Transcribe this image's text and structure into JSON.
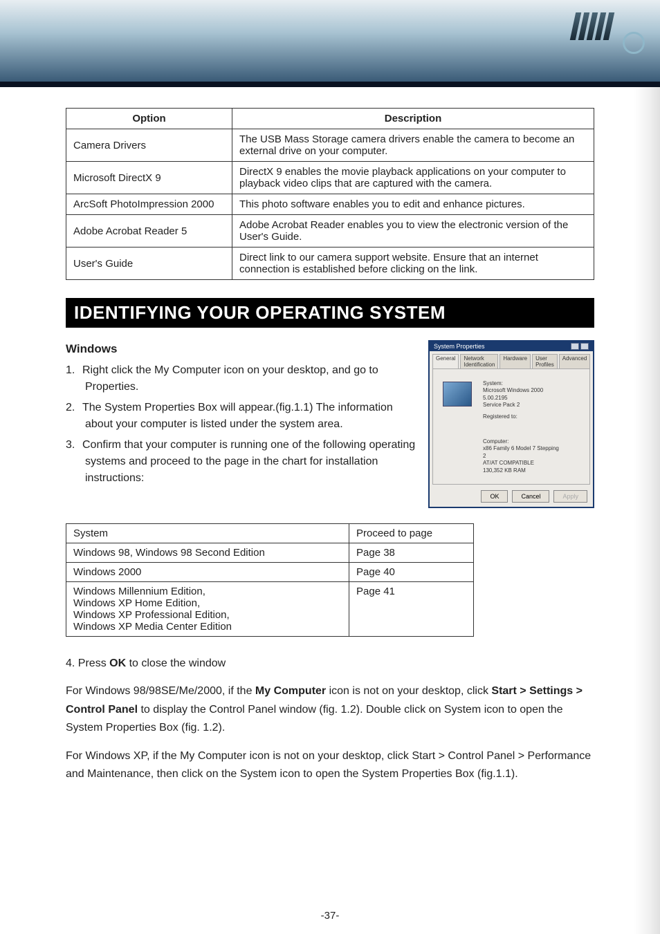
{
  "options_table": {
    "headers": {
      "option": "Option",
      "description": "Description"
    },
    "rows": [
      {
        "option": "Camera Drivers",
        "description": "The USB Mass Storage camera drivers enable the camera to become an external drive on your computer."
      },
      {
        "option": "Microsoft DirectX 9",
        "description": "DirectX 9 enables the movie playback applications on your computer to playback video clips that are captured with the camera."
      },
      {
        "option": "ArcSoft PhotoImpression 2000",
        "description": "This photo software enables you to edit and enhance pictures."
      },
      {
        "option": "Adobe Acrobat Reader 5",
        "description": "Adobe Acrobat Reader enables you to view the electronic version of the User's Guide."
      },
      {
        "option": "User's Guide",
        "description": "Direct link to our camera support website. Ensure that an internet connection is established before clicking on the link."
      }
    ]
  },
  "section_title": "IDENTIFYING YOUR OPERATING SYSTEM",
  "windows_heading": "Windows",
  "steps": [
    {
      "num": "1.",
      "text": "Right click the My Computer icon on your desktop, and go to Properties."
    },
    {
      "num": "2.",
      "text": "The System Properties Box will appear.(fig.1.1) The information about your computer is listed under the system area."
    },
    {
      "num": "3.",
      "text": "Confirm that your computer is running one of the following operating systems and proceed to the page in the chart for installation instructions:"
    }
  ],
  "sysprops": {
    "title": "System Properties",
    "tabs": [
      "General",
      "Network Identification",
      "Hardware",
      "User Profiles",
      "Advanced"
    ],
    "system_label": "System:",
    "system_lines": [
      "Microsoft Windows 2000",
      "5.00.2195",
      "Service Pack 2"
    ],
    "registered_label": "Registered to:",
    "computer_label": "Computer:",
    "computer_lines": [
      "x86 Family 6 Model 7 Stepping",
      "2",
      "AT/AT COMPATIBLE",
      "130,352 KB RAM"
    ],
    "ok": "OK",
    "cancel": "Cancel",
    "apply": "Apply"
  },
  "system_table": {
    "headers": {
      "system": "System",
      "page": "Proceed to page"
    },
    "rows": [
      {
        "system": "Windows 98, Windows 98 Second Edition",
        "page": "Page 38"
      },
      {
        "system": "Windows 2000",
        "page": "Page 40"
      },
      {
        "system": "Windows Millennium Edition,\nWindows XP Home Edition,\nWindows XP Professional Edition,\nWindows XP Media Center Edition",
        "page": "Page 41"
      }
    ]
  },
  "step4_prefix": "4.  Press ",
  "step4_bold": "OK",
  "step4_suffix": " to close the window",
  "para1_a": "For Windows 98/98SE/Me/2000, if the ",
  "para1_b": "My Computer",
  "para1_c": " icon is not on your desktop, click ",
  "para1_d": "Start > Settings > Control Panel",
  "para1_e": " to display the Control Panel window (fig. 1.2). Double click on System icon to open the System Properties Box (fig. 1.2).",
  "para2": "For Windows XP, if the My Computer icon is not on your desktop, click Start > Control Panel > Performance and Maintenance, then click on the System icon to open the System Properties Box (fig.1.1).",
  "page_number": "-37-"
}
